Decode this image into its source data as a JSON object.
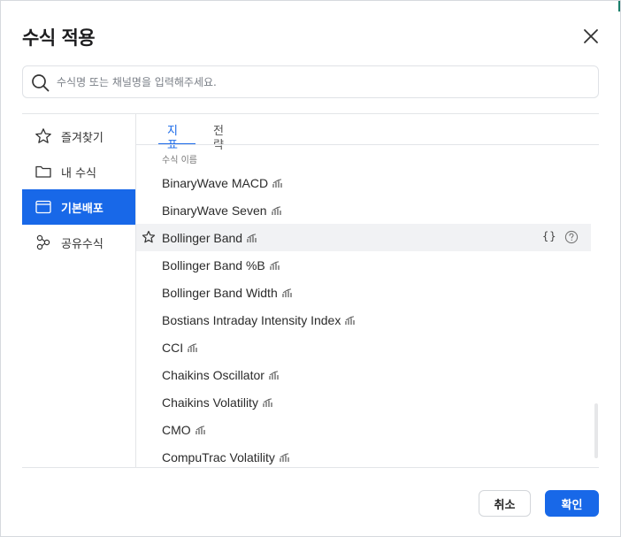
{
  "dialog": {
    "title": "수식 적용",
    "close_icon": "close-icon"
  },
  "search": {
    "placeholder": "수식명 또는 채널명을 입력해주세요.",
    "value": ""
  },
  "sidebar": {
    "items": [
      {
        "label": "즐겨찾기",
        "icon": "star-icon",
        "active": false
      },
      {
        "label": "내 수식",
        "icon": "folder-icon",
        "active": false
      },
      {
        "label": "기본배포",
        "icon": "window-icon",
        "active": true
      },
      {
        "label": "공유수식",
        "icon": "share-nodes-icon",
        "active": false
      }
    ]
  },
  "tabs": [
    {
      "label": "지표",
      "active": true
    },
    {
      "label": "전략",
      "active": false
    }
  ],
  "list": {
    "header": "수식 이름",
    "items": [
      {
        "name": "BinaryWave MACD"
      },
      {
        "name": "BinaryWave Seven"
      },
      {
        "name": "Bollinger Band",
        "hover": true,
        "code_label": "{}"
      },
      {
        "name": "Bollinger Band %B"
      },
      {
        "name": "Bollinger Band Width"
      },
      {
        "name": "Bostians Intraday Intensity Index"
      },
      {
        "name": "CCI"
      },
      {
        "name": "Chaikins Oscillator"
      },
      {
        "name": "Chaikins Volatility"
      },
      {
        "name": "CMO"
      },
      {
        "name": "CompuTrac Volatility"
      }
    ]
  },
  "buttons": {
    "cancel": "취소",
    "ok": "확인"
  },
  "colors": {
    "accent": "#1868e8",
    "hover_row": "#f1f2f4",
    "border": "#e3e5e8"
  }
}
